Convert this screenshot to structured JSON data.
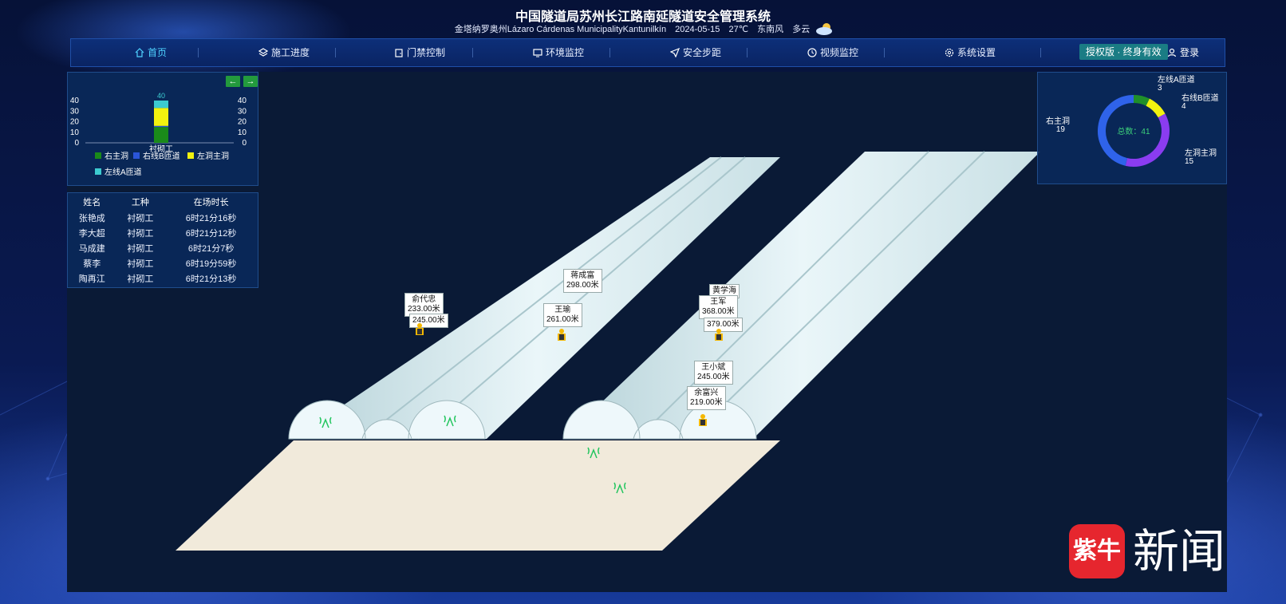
{
  "header": {
    "title": "中国隧道局苏州长江路南延隧道安全管理系统",
    "location": "金塔纳罗奥州Lázaro Cárdenas MunicipalityKantunilkín",
    "date": "2024-05-15",
    "temperature": "27℃",
    "wind": "东南风",
    "weather": "多云"
  },
  "nav": {
    "items": [
      {
        "label": "首页",
        "icon": "home-icon"
      },
      {
        "label": "施工进度",
        "icon": "layers-icon"
      },
      {
        "label": "门禁控制",
        "icon": "door-icon"
      },
      {
        "label": "环境监控",
        "icon": "monitor-icon"
      },
      {
        "label": "安全步距",
        "icon": "navigation-icon"
      },
      {
        "label": "视频监控",
        "icon": "clock-icon"
      },
      {
        "label": "系统设置",
        "icon": "gear-icon"
      }
    ],
    "license": "授权版 · 终身有效",
    "login": "登录"
  },
  "bar_chart": {
    "prev": "←",
    "next": "→",
    "legend": [
      "右主洞",
      "右线B匝道",
      "左洞主洞",
      "左线A匝道"
    ]
  },
  "table": {
    "headers": [
      "姓名",
      "工种",
      "在场时长"
    ],
    "rows": [
      [
        "张艳成",
        "衬砌工",
        "6时21分16秒"
      ],
      [
        "李大超",
        "衬砌工",
        "6时21分12秒"
      ],
      [
        "马成建",
        "衬砌工",
        "6时21分7秒"
      ],
      [
        "蔡李",
        "衬砌工",
        "6时19分59秒"
      ],
      [
        "陶再江",
        "衬砌工",
        "6时21分13秒"
      ]
    ]
  },
  "donut": {
    "center": "总数：41",
    "labels": [
      {
        "name": "左线A匝道",
        "value": "3"
      },
      {
        "name": "右线B匝道",
        "value": "4"
      },
      {
        "name": "左洞主洞",
        "value": "15"
      },
      {
        "name": "右主洞",
        "value": "19"
      }
    ]
  },
  "tags": [
    {
      "name": "俞代忠",
      "dist": "233.00米"
    },
    {
      "dist": "245.00米"
    },
    {
      "name": "蒋成富",
      "dist": "298.00米"
    },
    {
      "name": "王瑜",
      "dist": "261.00米"
    },
    {
      "name": "黄学海"
    },
    {
      "name": "王军",
      "dist": "368.00米"
    },
    {
      "dist": "379.00米"
    },
    {
      "name": "王小斌",
      "dist": "245.00米"
    },
    {
      "name": "余富兴",
      "dist": "219.00米"
    }
  ],
  "chart_data": [
    {
      "type": "bar",
      "categories": [
        "衬砌工"
      ],
      "series": [
        {
          "name": "右主洞",
          "values": [
            15
          ],
          "color": "#1a8a1a"
        },
        {
          "name": "右线B匝道",
          "values": [
            1
          ],
          "color": "#2a55d8"
        },
        {
          "name": "左洞主洞",
          "values": [
            17
          ],
          "color": "#f2f20f"
        },
        {
          "name": "左线A匝道",
          "values": [
            7
          ],
          "color": "#3ccbd0"
        }
      ],
      "total_labels": [
        "40"
      ],
      "yticks": [
        "0",
        "10",
        "20",
        "30",
        "40"
      ],
      "ylim": [
        0,
        40
      ],
      "stacked": true,
      "xlabel": "衬砌工",
      "title": ""
    },
    {
      "type": "pie",
      "donut": true,
      "slices": [
        {
          "name": "左线A匝道",
          "value": 3,
          "color": "#1f8f2a"
        },
        {
          "name": "右线B匝道",
          "value": 4,
          "color": "#f2f20f"
        },
        {
          "name": "左洞主洞",
          "value": 15,
          "color": "#8a3cf0"
        },
        {
          "name": "右主洞",
          "value": 19,
          "color": "#2f63ea"
        }
      ]
    }
  ],
  "watermark": {
    "logo": "紫牛",
    "text": "新闻"
  },
  "colors": {
    "accent": "#4fd2ff",
    "nav_bg": "#0d2f79",
    "panel_bg": "#0a285a"
  }
}
